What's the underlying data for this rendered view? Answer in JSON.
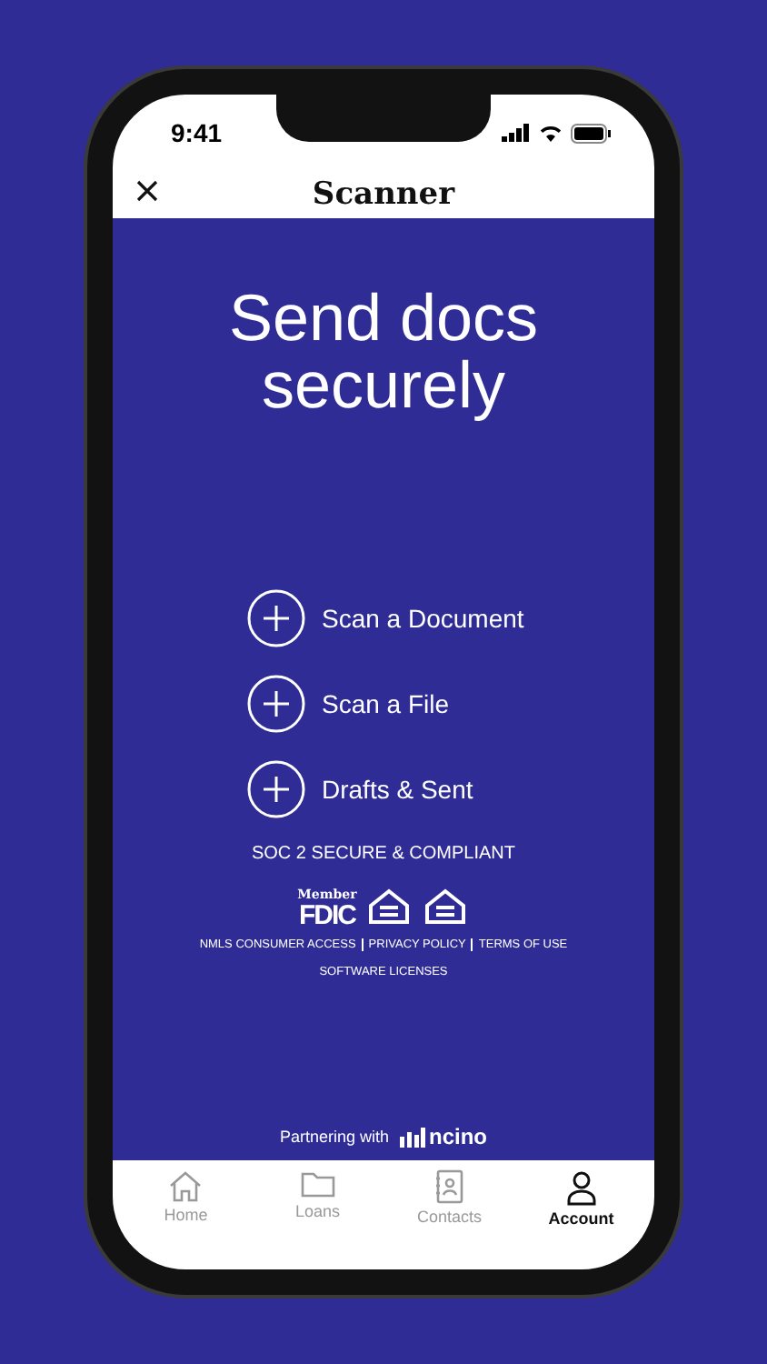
{
  "status_bar": {
    "time": "9:41"
  },
  "header": {
    "title": "Scanner"
  },
  "hero": {
    "title": "Send docs securely"
  },
  "actions": [
    {
      "label": "Scan a Document"
    },
    {
      "label": "Scan a File"
    },
    {
      "label": "Drafts & Sent"
    }
  ],
  "compliance": "SOC 2 SECURE & COMPLIANT",
  "fdic": {
    "small": "Member",
    "big": "FDIC"
  },
  "links": [
    {
      "label": "NMLS CONSUMER ACCESS"
    },
    {
      "label": "PRIVACY POLICY"
    },
    {
      "label": "TERMS OF USE"
    },
    {
      "label": "SOFTWARE LICENSES"
    }
  ],
  "partner": {
    "text": "Partnering with",
    "brand": "ncino"
  },
  "tabs": [
    {
      "label": "Home",
      "kind": "home",
      "selected": false
    },
    {
      "label": "Loans",
      "kind": "folder",
      "selected": false
    },
    {
      "label": "Contacts",
      "kind": "contacts",
      "selected": false
    },
    {
      "label": "Account",
      "kind": "person",
      "selected": true
    }
  ]
}
